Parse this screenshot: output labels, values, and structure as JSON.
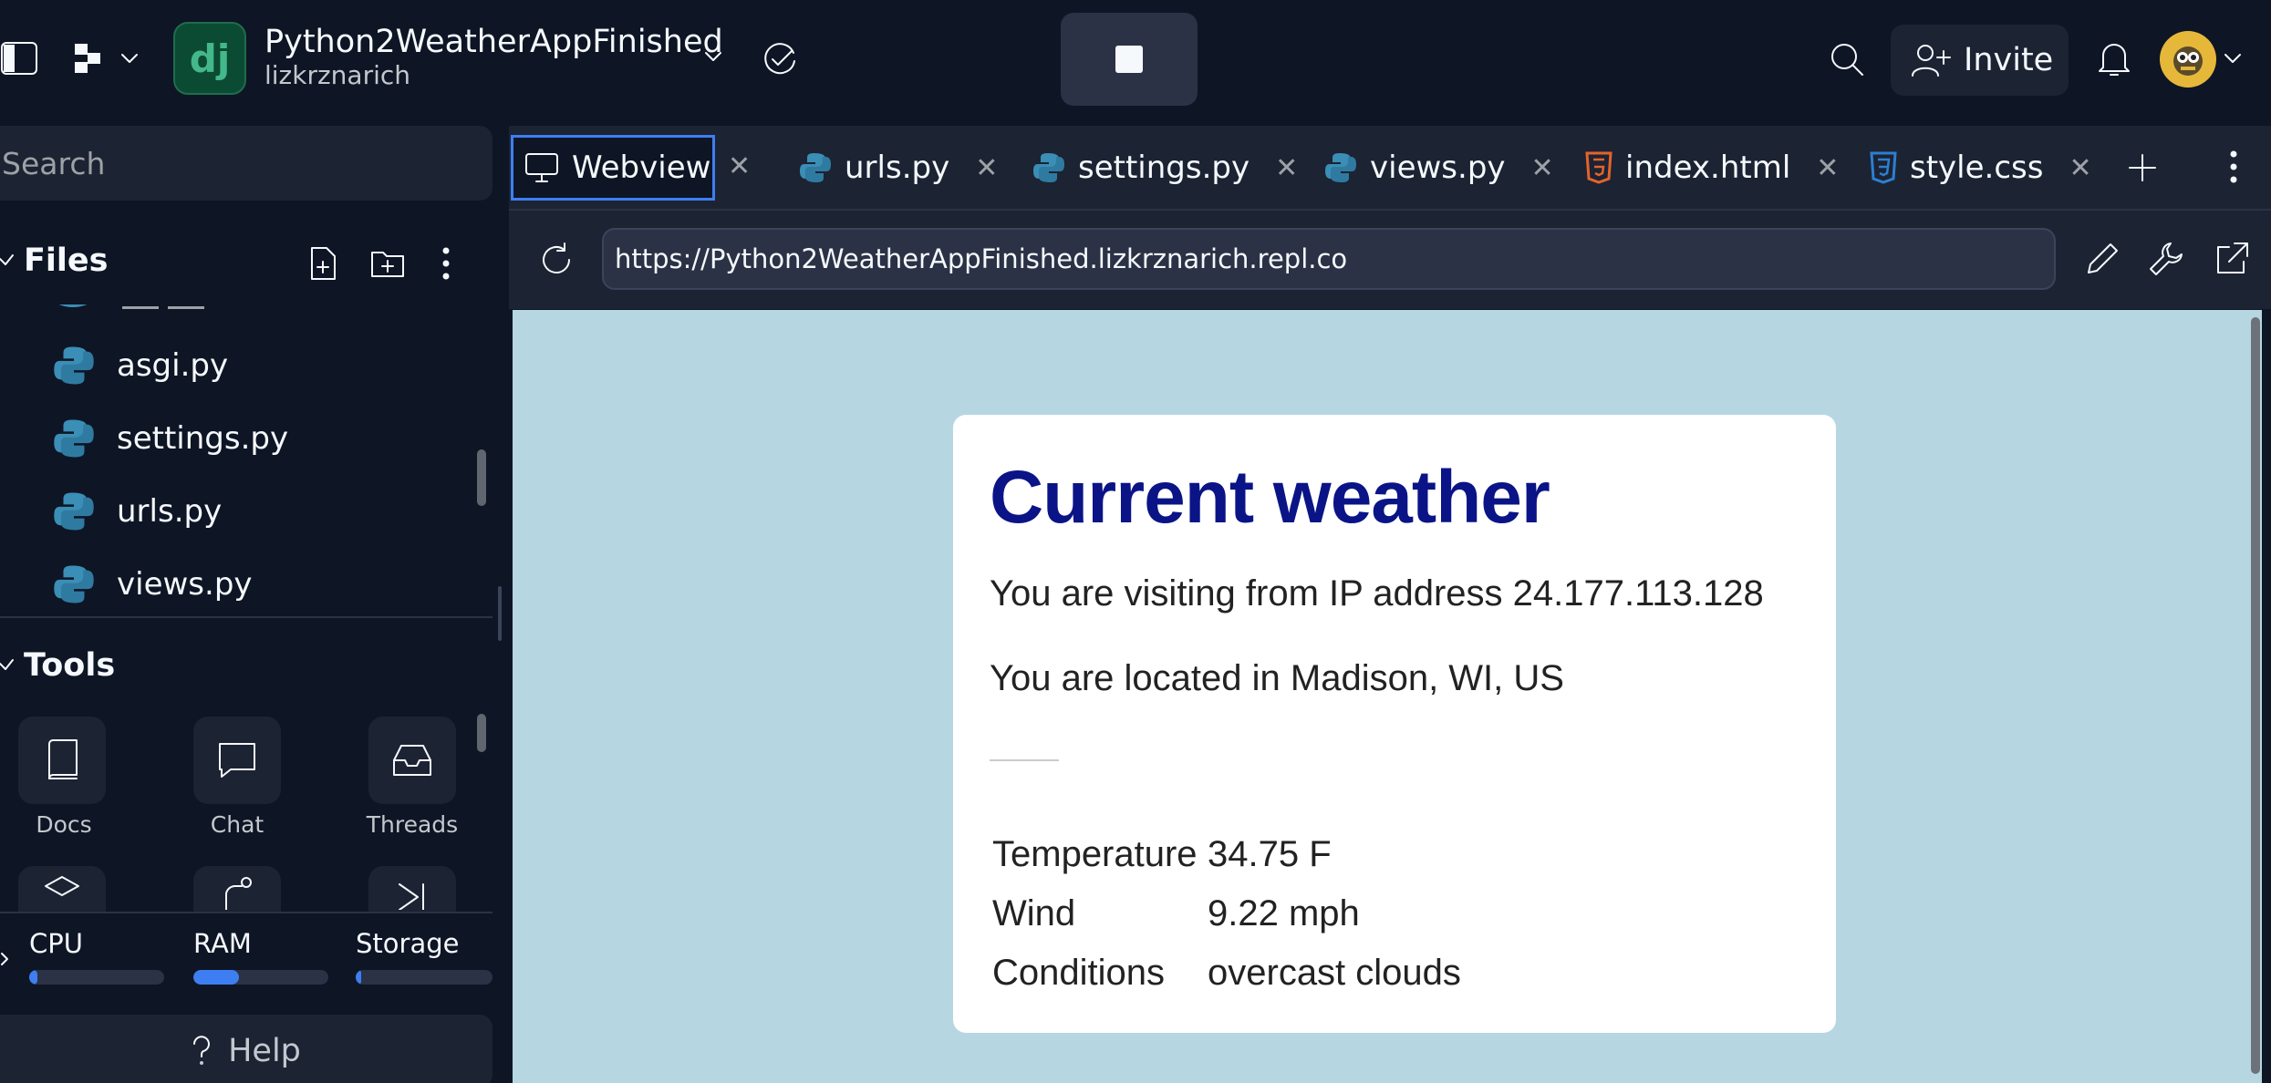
{
  "topbar": {
    "app_logo_text": "dj",
    "repl_title": "Python2WeatherAppFinished",
    "repl_owner": "lizkrznarich",
    "invite_label": "Invite",
    "icons": [
      "sidebar-toggle-icon",
      "workspace-icon",
      "chevron-down-icon",
      "cloud-check-icon",
      "search-icon",
      "user-plus-icon",
      "bell-icon"
    ]
  },
  "sidebar": {
    "search_placeholder": "Search",
    "files_title": "Files",
    "files": [
      "asgi.py",
      "settings.py",
      "urls.py",
      "views.py"
    ],
    "tools_title": "Tools",
    "tools": [
      "Docs",
      "Chat",
      "Threads"
    ],
    "usage": {
      "cpu_label": "CPU",
      "ram_label": "RAM",
      "storage_label": "Storage",
      "cpu_percent": 6,
      "ram_percent": 34,
      "storage_percent": 4
    },
    "help_label": "Help"
  },
  "tabs": [
    {
      "label": "Webview",
      "icon": "monitor-icon",
      "active": true
    },
    {
      "label": "urls.py",
      "icon": "python-icon"
    },
    {
      "label": "settings.py",
      "icon": "python-icon"
    },
    {
      "label": "views.py",
      "icon": "python-icon"
    },
    {
      "label": "index.html",
      "icon": "html5-icon"
    },
    {
      "label": "style.css",
      "icon": "css3-icon"
    }
  ],
  "webview": {
    "url": "https://Python2WeatherAppFinished.lizkrznarich.repl.co",
    "card": {
      "title": "Current weather",
      "ip_line": "You are visiting from IP address 24.177.113.128",
      "location_line": "You are located in Madison, WI, US",
      "rows": [
        {
          "key": "Temperature",
          "value": "34.75 F"
        },
        {
          "key": "Wind",
          "value": "9.22 mph"
        },
        {
          "key": "Conditions",
          "value": "overcast clouds"
        }
      ]
    }
  },
  "colors": {
    "background": "#0e1525",
    "surface": "#1c2333",
    "accent": "#3d7ff2",
    "webview_bg": "#b6d6e2",
    "title_blue": "#0a1487"
  }
}
